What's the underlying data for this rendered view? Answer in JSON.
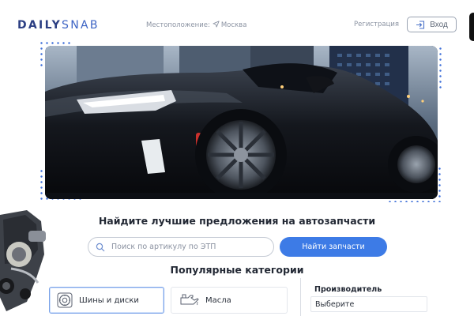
{
  "header": {
    "logo_bold": "DAILY",
    "logo_light": "SNAB",
    "location_label": "Местоположение:",
    "location_city": "Москва",
    "register_label": "Регистрация",
    "login_label": "Вход"
  },
  "hero": {
    "image": "black-sports-car-photo"
  },
  "search": {
    "headline": "Найдите лучшие предложения на автозапчасти",
    "placeholder": "Поиск по артикулу по ЭТП",
    "button_label": "Найти запчасти"
  },
  "categories": {
    "title": "Популярные категории",
    "items": [
      {
        "label": "Шины и диски",
        "icon": "tire-icon"
      },
      {
        "label": "Масла",
        "icon": "oil-can-icon"
      }
    ]
  },
  "manufacturer": {
    "label": "Производитель",
    "selected": "Выберите"
  },
  "colors": {
    "brand": "#2c3f83",
    "accent": "#3d7be6",
    "dots": "#3e6fd8"
  }
}
